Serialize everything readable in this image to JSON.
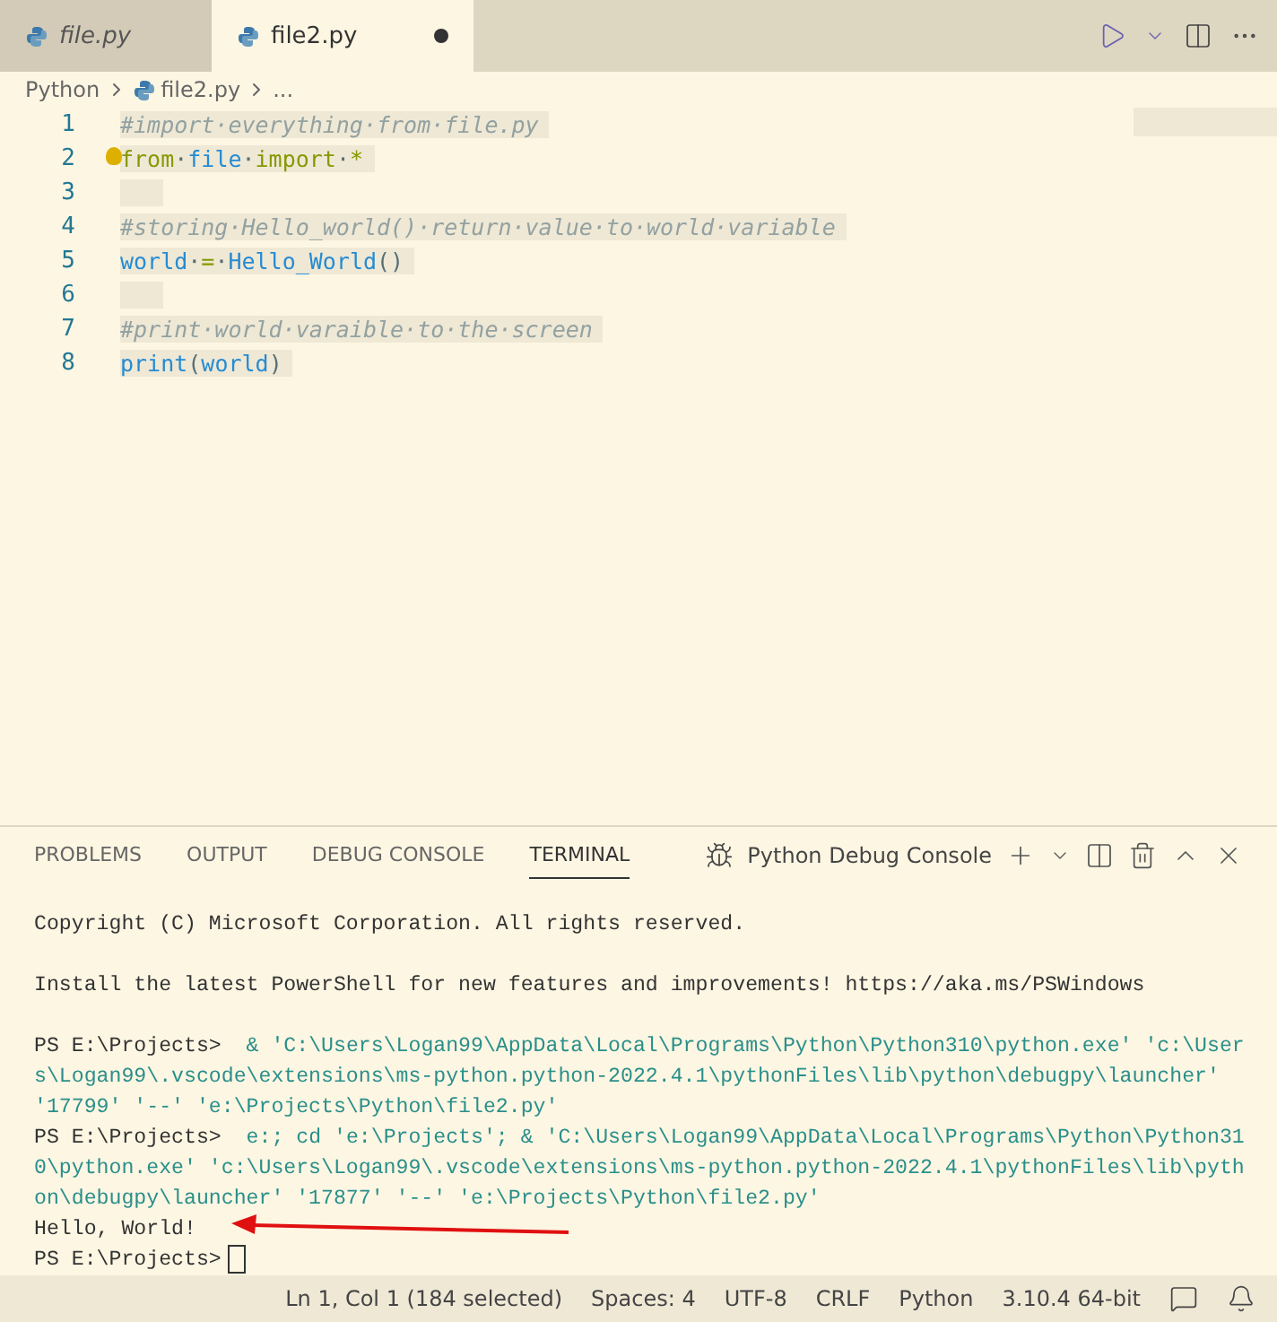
{
  "tabs": [
    {
      "label": "file.py",
      "selected": false,
      "preview": true,
      "dirty": false
    },
    {
      "label": "file2.py",
      "selected": true,
      "preview": false,
      "dirty": true
    }
  ],
  "breadcrumbs": [
    "Python",
    "file2.py",
    "..."
  ],
  "code": [
    {
      "number": "1",
      "tokens": [
        {
          "kind": "comment",
          "text": "#import·everything·from·file.py"
        }
      ]
    },
    {
      "number": "2",
      "lightbulb": true,
      "tokens": [
        {
          "kind": "keyword",
          "text": "from"
        },
        {
          "kind": "plain",
          "text": "·"
        },
        {
          "kind": "name",
          "text": "file"
        },
        {
          "kind": "plain",
          "text": "·"
        },
        {
          "kind": "keyword",
          "text": "import"
        },
        {
          "kind": "plain",
          "text": "·"
        },
        {
          "kind": "keyword",
          "text": "*"
        }
      ]
    },
    {
      "number": "3"
    },
    {
      "number": "4",
      "tokens": [
        {
          "kind": "comment",
          "text": "#storing·Hello_world()·return·value·to·world·variable"
        }
      ]
    },
    {
      "number": "5",
      "tokens": [
        {
          "kind": "name",
          "text": "world"
        },
        {
          "kind": "plain",
          "text": "·"
        },
        {
          "kind": "keyword",
          "text": "="
        },
        {
          "kind": "plain",
          "text": "·"
        },
        {
          "kind": "name",
          "text": "Hello_World"
        },
        {
          "kind": "plain",
          "text": "()"
        }
      ]
    },
    {
      "number": "6"
    },
    {
      "number": "7",
      "tokens": [
        {
          "kind": "comment",
          "text": "#print·world·varaible·to·the·screen"
        }
      ]
    },
    {
      "number": "8",
      "tokens": [
        {
          "kind": "name",
          "text": "print"
        },
        {
          "kind": "plain",
          "text": "("
        },
        {
          "kind": "name",
          "text": "world"
        },
        {
          "kind": "plain",
          "text": ")"
        }
      ]
    }
  ],
  "panel_tabs": [
    {
      "label": "PROBLEMS",
      "selected": false
    },
    {
      "label": "OUTPUT",
      "selected": false
    },
    {
      "label": "DEBUG CONSOLE",
      "selected": false
    },
    {
      "label": "TERMINAL",
      "selected": true
    }
  ],
  "terminal_name": "Python Debug Console",
  "terminal": [
    {
      "kind": "output",
      "text": "Copyright (C) Microsoft Corporation. All rights reserved."
    },
    {
      "kind": "blank"
    },
    {
      "kind": "output",
      "text": "Install the latest PowerShell for new features and improvements! https://aka.ms/PSWindows"
    },
    {
      "kind": "blank"
    },
    {
      "kind": "command",
      "prompt": "PS E:\\Projects> ",
      "text": " & 'C:\\Users\\Logan99\\AppData\\Local\\Programs\\Python\\Python310\\python.exe' 'c:\\Users\\Logan99\\.vscode\\extensions\\ms-python.python-2022.4.1\\pythonFiles\\lib\\python\\debugpy\\launcher' '17799' '--' 'e:\\Projects\\Python\\file2.py'"
    },
    {
      "kind": "command",
      "prompt": "PS E:\\Projects> ",
      "text": " e:; cd 'e:\\Projects'; & 'C:\\Users\\Logan99\\AppData\\Local\\Programs\\Python\\Python310\\python.exe' 'c:\\Users\\Logan99\\.vscode\\extensions\\ms-python.python-2022.4.1\\pythonFiles\\lib\\python\\debugpy\\launcher' '17877' '--' 'e:\\Projects\\Python\\file2.py'"
    },
    {
      "kind": "output",
      "text": "Hello, World!",
      "annotated": true
    },
    {
      "kind": "cursor",
      "prompt": "PS E:\\Projects>"
    }
  ],
  "status_bar": [
    "Ln 1, Col 1 (184 selected)",
    "Spaces: 4",
    "UTF-8",
    "CRLF",
    "Python",
    "3.10.4 64-bit"
  ]
}
